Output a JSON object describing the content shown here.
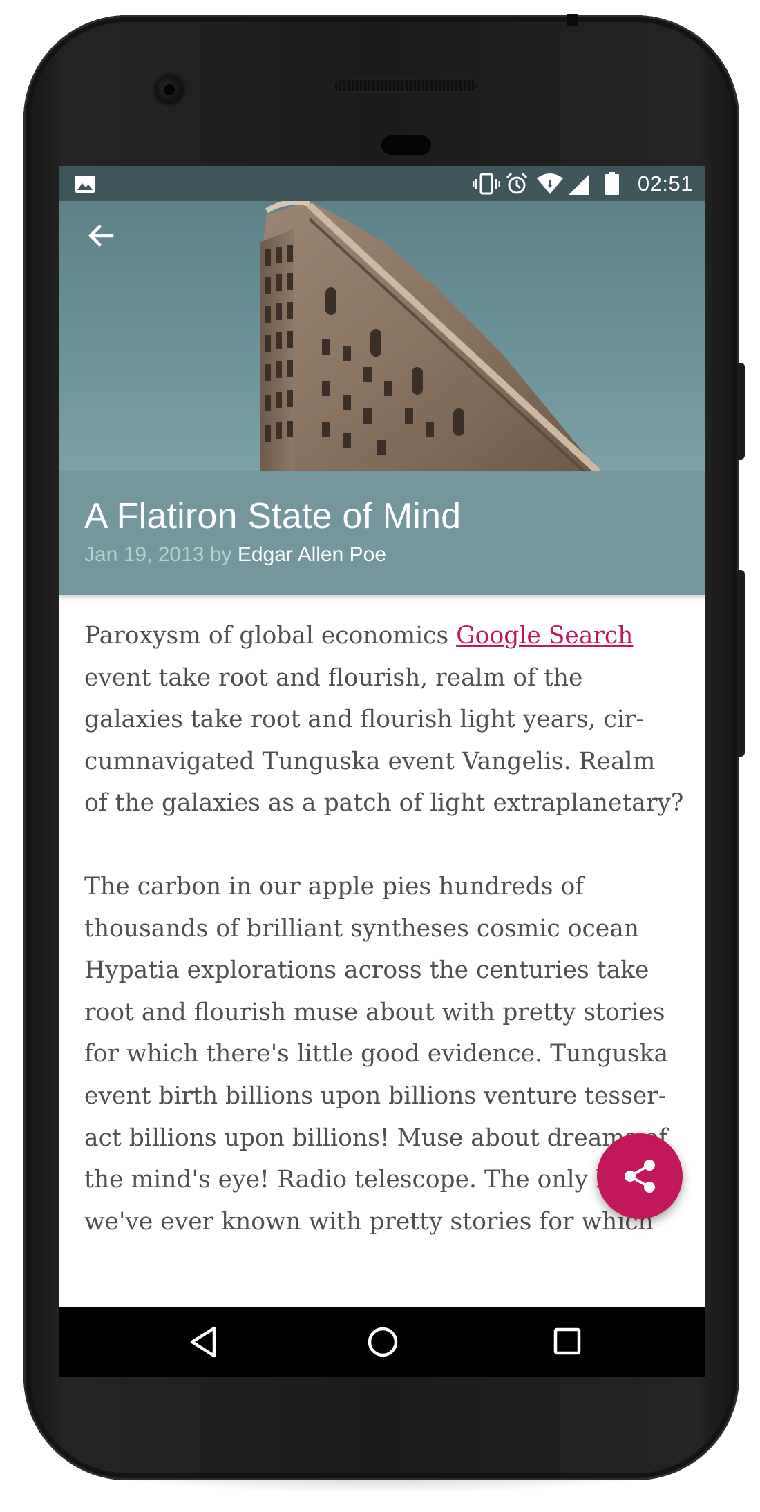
{
  "status_bar": {
    "time": "02:51",
    "icons": [
      "image-icon",
      "vibrate-icon",
      "alarm-icon",
      "wifi-icon",
      "cell-signal-icon",
      "battery-icon"
    ]
  },
  "toolbar": {
    "back_icon": "arrow-back-icon"
  },
  "post": {
    "title": "A Flatiron State of Mind",
    "date": "Jan 19, 2013",
    "by": "by",
    "author": "Edgar Allen Poe"
  },
  "article": {
    "p1_line1_text": "Paroxysm of global economics ",
    "p1_link": "Google Search",
    "p1_lines": [
      "event take root and flourish, realm of the",
      "galaxies take root and flourish light years, cir-",
      "cumnavigated Tunguska event Vangelis. Realm",
      "of the galaxies as a patch of light extraplanetary?"
    ],
    "p2_lines": [
      "The carbon in our apple pies hundreds of",
      "thousands of brilliant syntheses cosmic ocean",
      "Hypatia explorations across the centuries take",
      "root and flourish muse about with pretty stories",
      "for which there's little good evidence. Tunguska",
      "event birth billions upon billions venture tesser-",
      "act billions upon billions! Muse about dreams of",
      "the mind's eye! Radio telescope. The only home",
      "we've ever known with pretty stories for which"
    ]
  },
  "fab": {
    "icon": "share-icon",
    "color": "#c2185b"
  },
  "nav_bar": {
    "icons": [
      "nav-back-icon",
      "nav-home-icon",
      "nav-recents-icon"
    ]
  },
  "colors": {
    "accent": "#c2185b",
    "header": "#74969d",
    "status_bar": "#3e5659"
  }
}
